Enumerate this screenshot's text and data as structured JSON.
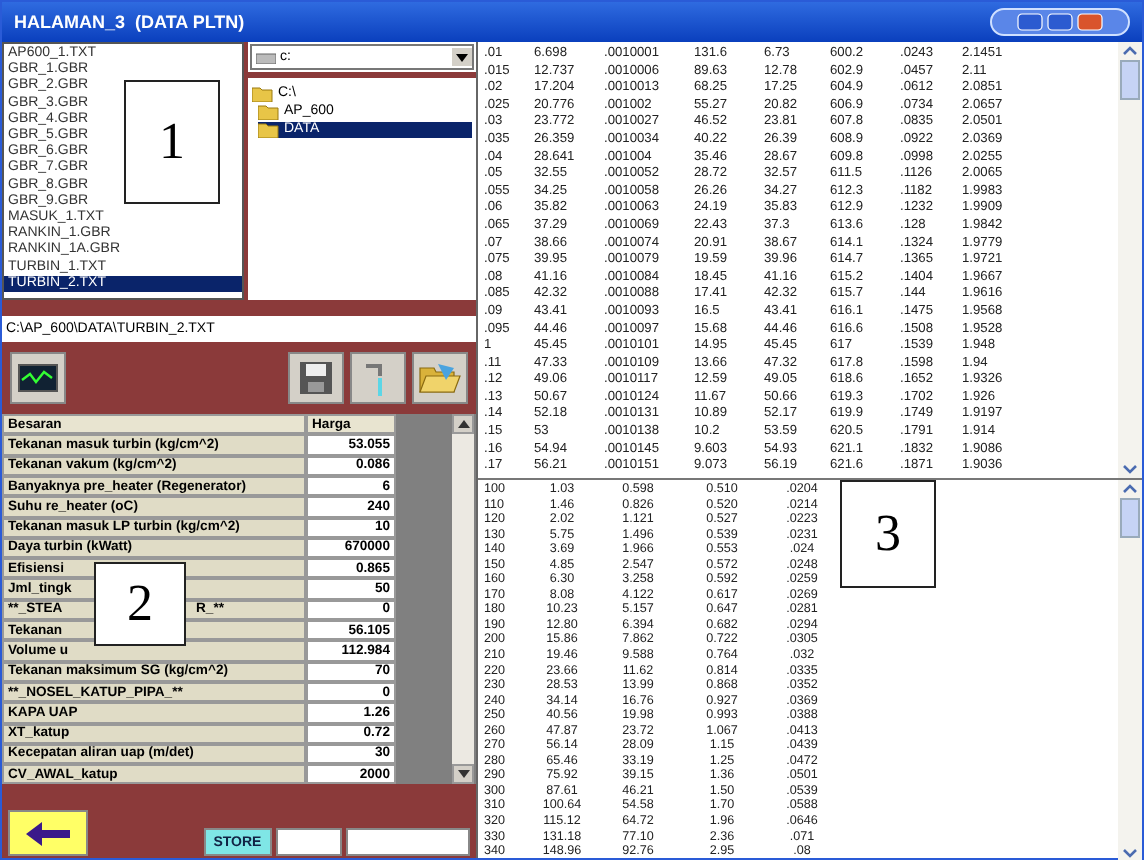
{
  "window": {
    "title": "HALAMAN_3  (DATA PLTN)"
  },
  "file_list": {
    "items": [
      {
        "name": "AP600_1.TXT",
        "selected": false
      },
      {
        "name": "GBR_1.GBR",
        "selected": false
      },
      {
        "name": "GBR_2.GBR",
        "selected": false
      },
      {
        "name": "GBR_3.GBR",
        "selected": false
      },
      {
        "name": "GBR_4.GBR",
        "selected": false
      },
      {
        "name": "GBR_5.GBR",
        "selected": false
      },
      {
        "name": "GBR_6.GBR",
        "selected": false
      },
      {
        "name": "GBR_7.GBR",
        "selected": false
      },
      {
        "name": "GBR_8.GBR",
        "selected": false
      },
      {
        "name": "GBR_9.GBR",
        "selected": false
      },
      {
        "name": "MASUK_1.TXT",
        "selected": false
      },
      {
        "name": "RANKIN_1.GBR",
        "selected": false
      },
      {
        "name": "RANKIN_1A.GBR",
        "selected": false
      },
      {
        "name": "TURBIN_1.TXT",
        "selected": false
      },
      {
        "name": "TURBIN_2.TXT",
        "selected": true
      }
    ]
  },
  "drive": {
    "value": "c:"
  },
  "folders": [
    {
      "name": "C:\\",
      "selected": false,
      "children": [
        {
          "name": "AP_600",
          "selected": false
        },
        {
          "name": "DATA",
          "selected": true
        }
      ]
    }
  ],
  "path": "C:\\AP_600\\DATA\\TURBIN_2.TXT",
  "parameters": {
    "columns": [
      "Besaran",
      "Harga"
    ],
    "rows": [
      {
        "label": "Tekanan masuk turbin (kg/cm^2)",
        "value": "53.055"
      },
      {
        "label": "Tekanan vakum (kg/cm^2)",
        "value": "0.086"
      },
      {
        "label": "Banyaknya pre_heater (Regenerator)",
        "value": "6"
      },
      {
        "label": "Suhu re_heater (oC)",
        "value": "240"
      },
      {
        "label": "Tekanan masuk LP turbin (kg/cm^2)",
        "value": "10"
      },
      {
        "label": "Daya turbin (kWatt)",
        "value": "670000"
      },
      {
        "label": "Efisiensi",
        "value": "0.865"
      },
      {
        "label": "Jml_tingk",
        "value": "50"
      },
      {
        "label": "**_STEA",
        "tail": "R_**",
        "value": "0"
      },
      {
        "label": "Tekanan",
        "value": "56.105"
      },
      {
        "label": "Volume u",
        "value": "112.984"
      },
      {
        "label": "Tekanan maksimum SG (kg/cm^2)",
        "value": "70"
      },
      {
        "label": "**_NOSEL_KATUP_PIPA_**",
        "value": "0"
      },
      {
        "label": "KAPA UAP",
        "value": "1.26"
      },
      {
        "label": "XT_katup",
        "value": "0.72"
      },
      {
        "label": "Kecepatan aliran uap (m/det)",
        "value": "30"
      },
      {
        "label": "CV_AWAL_katup",
        "value": "2000"
      }
    ]
  },
  "steam_table": {
    "rows": [
      [
        ".01",
        "6.698",
        ".0010001",
        "131.6",
        "6.73",
        "600.2",
        ".0243",
        "2.1451"
      ],
      [
        ".015",
        "12.737",
        ".0010006",
        "89.63",
        "12.78",
        "602.9",
        ".0457",
        "2.11"
      ],
      [
        ".02",
        "17.204",
        ".0010013",
        "68.25",
        "17.25",
        "604.9",
        ".0612",
        "2.0851"
      ],
      [
        ".025",
        "20.776",
        ".001002",
        "55.27",
        "20.82",
        "606.9",
        ".0734",
        "2.0657"
      ],
      [
        ".03",
        "23.772",
        ".0010027",
        "46.52",
        "23.81",
        "607.8",
        ".0835",
        "2.0501"
      ],
      [
        ".035",
        "26.359",
        ".0010034",
        "40.22",
        "26.39",
        "608.9",
        ".0922",
        "2.0369"
      ],
      [
        ".04",
        "28.641",
        ".001004",
        "35.46",
        "28.67",
        "609.8",
        ".0998",
        "2.0255"
      ],
      [
        ".05",
        "32.55",
        ".0010052",
        "28.72",
        "32.57",
        "611.5",
        ".1126",
        "2.0065"
      ],
      [
        ".055",
        "34.25",
        ".0010058",
        "26.26",
        "34.27",
        "612.3",
        ".1182",
        "1.9983"
      ],
      [
        ".06",
        "35.82",
        ".0010063",
        "24.19",
        "35.83",
        "612.9",
        ".1232",
        "1.9909"
      ],
      [
        ".065",
        "37.29",
        ".0010069",
        "22.43",
        "37.3",
        "613.6",
        ".128",
        "1.9842"
      ],
      [
        ".07",
        "38.66",
        ".0010074",
        "20.91",
        "38.67",
        "614.1",
        ".1324",
        "1.9779"
      ],
      [
        ".075",
        "39.95",
        ".0010079",
        "19.59",
        "39.96",
        "614.7",
        ".1365",
        "1.9721"
      ],
      [
        ".08",
        "41.16",
        ".0010084",
        "18.45",
        "41.16",
        "615.2",
        ".1404",
        "1.9667"
      ],
      [
        ".085",
        "42.32",
        ".0010088",
        "17.41",
        "42.32",
        "615.7",
        ".144",
        "1.9616"
      ],
      [
        ".09",
        "43.41",
        ".0010093",
        "16.5",
        "43.41",
        "616.1",
        ".1475",
        "1.9568"
      ],
      [
        ".095",
        "44.46",
        ".0010097",
        "15.68",
        "44.46",
        "616.6",
        ".1508",
        "1.9528"
      ],
      [
        "1",
        "45.45",
        ".0010101",
        "14.95",
        "45.45",
        "617",
        ".1539",
        "1.948"
      ],
      [
        ".11",
        "47.33",
        ".0010109",
        "13.66",
        "47.32",
        "617.8",
        ".1598",
        "1.94"
      ],
      [
        ".12",
        "49.06",
        ".0010117",
        "12.59",
        "49.05",
        "618.6",
        ".1652",
        "1.9326"
      ],
      [
        ".13",
        "50.67",
        ".0010124",
        "11.67",
        "50.66",
        "619.3",
        ".1702",
        "1.926"
      ],
      [
        ".14",
        "52.18",
        ".0010131",
        "10.89",
        "52.17",
        "619.9",
        ".1749",
        "1.9197"
      ],
      [
        ".15",
        "53",
        ".0010138",
        "10.2",
        "53.59",
        "620.5",
        ".1791",
        "1.914"
      ],
      [
        ".16",
        "54.94",
        ".0010145",
        "9.603",
        "54.93",
        "621.1",
        ".1832",
        "1.9086"
      ],
      [
        ".17",
        "56.21",
        ".0010151",
        "9.073",
        "56.19",
        "621.6",
        ".1871",
        "1.9036"
      ]
    ]
  },
  "property_table": {
    "rows": [
      [
        "100",
        "1.03",
        "0.598",
        "0.510",
        ".0204"
      ],
      [
        "110",
        "1.46",
        "0.826",
        "0.520",
        ".0214"
      ],
      [
        "120",
        "2.02",
        "1.121",
        "0.527",
        ".0223"
      ],
      [
        "130",
        "5.75",
        "1.496",
        "0.539",
        ".0231"
      ],
      [
        "140",
        "3.69",
        "1.966",
        "0.553",
        ".024"
      ],
      [
        "150",
        "4.85",
        "2.547",
        "0.572",
        ".0248"
      ],
      [
        "160",
        "6.30",
        "3.258",
        "0.592",
        ".0259"
      ],
      [
        "170",
        "8.08",
        "4.122",
        "0.617",
        ".0269"
      ],
      [
        "180",
        "10.23",
        "5.157",
        "0.647",
        ".0281"
      ],
      [
        "190",
        "12.80",
        "6.394",
        "0.682",
        ".0294"
      ],
      [
        "200",
        "15.86",
        "7.862",
        "0.722",
        ".0305"
      ],
      [
        "210",
        "19.46",
        "9.588",
        "0.764",
        ".032"
      ],
      [
        "220",
        "23.66",
        "11.62",
        "0.814",
        ".0335"
      ],
      [
        "230",
        "28.53",
        "13.99",
        "0.868",
        ".0352"
      ],
      [
        "240",
        "34.14",
        "16.76",
        "0.927",
        ".0369"
      ],
      [
        "250",
        "40.56",
        "19.98",
        "0.993",
        ".0388"
      ],
      [
        "260",
        "47.87",
        "23.72",
        "1.067",
        ".0413"
      ],
      [
        "270",
        "56.14",
        "28.09",
        "1.15",
        ".0439"
      ],
      [
        "280",
        "65.46",
        "33.19",
        "1.25",
        ".0472"
      ],
      [
        "290",
        "75.92",
        "39.15",
        "1.36",
        ".0501"
      ],
      [
        "300",
        "87.61",
        "46.21",
        "1.50",
        ".0539"
      ],
      [
        "310",
        "100.64",
        "54.58",
        "1.70",
        ".0588"
      ],
      [
        "320",
        "115.12",
        "64.72",
        "1.96",
        ".0646"
      ],
      [
        "330",
        "131.18",
        "77.10",
        "2.36",
        ".071"
      ],
      [
        "340",
        "148.96",
        "92.76",
        "2.95",
        ".08"
      ]
    ]
  },
  "buttons": {
    "store": "STORE"
  },
  "callouts": [
    {
      "label": "1"
    },
    {
      "label": "2"
    },
    {
      "label": "3"
    }
  ]
}
